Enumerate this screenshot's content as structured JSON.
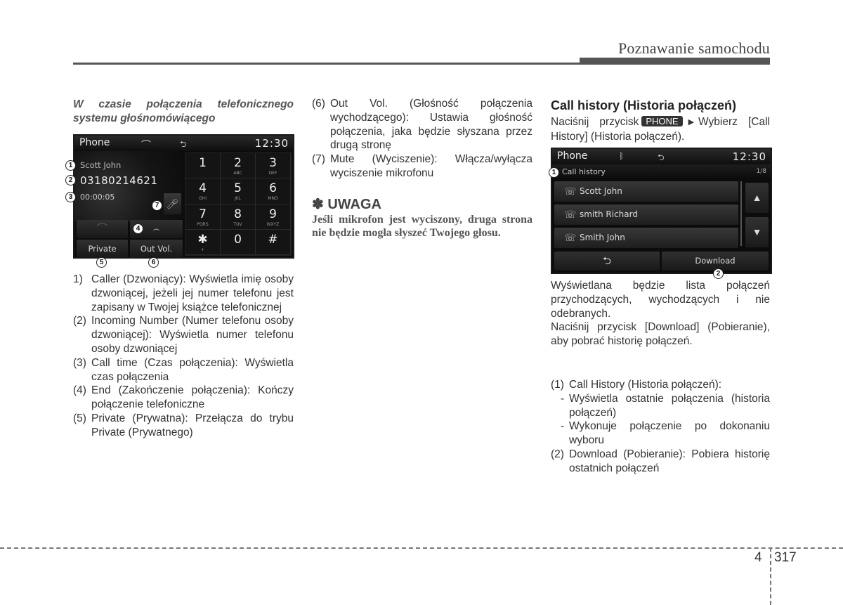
{
  "header": {
    "section_title": "Poznawanie samochodu"
  },
  "footer": {
    "chapter": "4",
    "page": "317"
  },
  "left_column": {
    "subheading": "W czasie połączenia telefonicznego systemu głośnomówiącego",
    "items": [
      {
        "num": "1)",
        "text": "Caller (Dzwoniący): Wyświetla imię osoby dzwoniącej, jeżeli jej numer telefonu jest zapisany w Twojej książce telefonicznej"
      },
      {
        "num": "(2)",
        "text": "Incoming Number (Numer telefonu osoby dzwoniącej): Wyświetla numer telefonu osoby dzwoniącej"
      },
      {
        "num": "(3)",
        "text": "Call time (Czas połączenia): Wyświetla czas połączenia"
      },
      {
        "num": "(4)",
        "text": "End (Zakończenie połączenia): Kończy połączenie telefoniczne"
      },
      {
        "num": "(5)",
        "text": "Private (Prywatna): Przełącza do trybu Private (Prywatnego)"
      }
    ]
  },
  "middle_column": {
    "items": [
      {
        "num": "(6)",
        "text": "Out Vol. (Głośność połączenia wychodzącego): Ustawia głośność połączenia, jaka będzie słyszana przez drugą stronę"
      },
      {
        "num": "(7)",
        "text": "Mute (Wyciszenie): Włącza/wyłącza wyciszenie mikrofonu"
      }
    ],
    "note": {
      "symbol": "✽",
      "title": "UWAGA",
      "text": "Jeśli mikrofon jest wyciszony, druga strona nie będzie mogła słyszeć Twojego głosu."
    }
  },
  "right_column": {
    "heading": "Call history (Historia połączeń)",
    "instruction_before": "Naciśnij przycisk",
    "button_badge": "PHONE",
    "arrow": "▶",
    "instruction_after": "Wybierz [Call History] (Historia połączeń).",
    "paragraph_1": "Wyświetlana będzie lista połączeń przychodzących, wychodzących i nie odebranych.",
    "paragraph_2": "Naciśnij przycisk [Download] (Pobieranie), aby pobrać historię połączeń.",
    "items": [
      {
        "num": "(1)",
        "text": "Call History (Historia połączeń):",
        "sub": [
          "Wyświetla ostatnie połączenia (historia połączeń)",
          "Wykonuje połączenie po dokonaniu wyboru"
        ]
      },
      {
        "num": "(2)",
        "text": "Download (Pobieranie): Pobiera historię ostatnich połączeń"
      }
    ]
  },
  "phone_screen": {
    "title": "Phone",
    "time": "12:30",
    "status_icons": [
      "phone-handset-icon",
      "usb-icon"
    ],
    "caller": "Scott John",
    "number": "03180214621",
    "call_time": "00:00:05",
    "buttons": {
      "private": "Private",
      "out_vol": "Out Vol."
    },
    "keypad": [
      {
        "digit": "1",
        "letters": ""
      },
      {
        "digit": "2",
        "letters": "ABC"
      },
      {
        "digit": "3",
        "letters": "DEF"
      },
      {
        "digit": "4",
        "letters": "GHI"
      },
      {
        "digit": "5",
        "letters": "JKL"
      },
      {
        "digit": "6",
        "letters": "MNO"
      },
      {
        "digit": "7",
        "letters": "PQRS"
      },
      {
        "digit": "8",
        "letters": "TUV"
      },
      {
        "digit": "9",
        "letters": "WXYZ"
      },
      {
        "digit": "✱",
        "letters": "+"
      },
      {
        "digit": "0",
        "letters": ""
      },
      {
        "digit": "#",
        "letters": ""
      }
    ],
    "callouts": [
      "1",
      "2",
      "3",
      "4",
      "5",
      "6",
      "7"
    ]
  },
  "history_screen": {
    "title": "Phone",
    "time": "12:30",
    "status_icons": [
      "bluetooth-icon",
      "usb-icon"
    ],
    "subtitle": "Call history",
    "page_indicator": "1/8",
    "entries": [
      {
        "name": "Scott John",
        "type": "missed"
      },
      {
        "name": "smith Richard",
        "type": "outgoing"
      },
      {
        "name": "Smith John",
        "type": "outgoing"
      }
    ],
    "download_label": "Download",
    "callouts": [
      "1",
      "2"
    ]
  }
}
